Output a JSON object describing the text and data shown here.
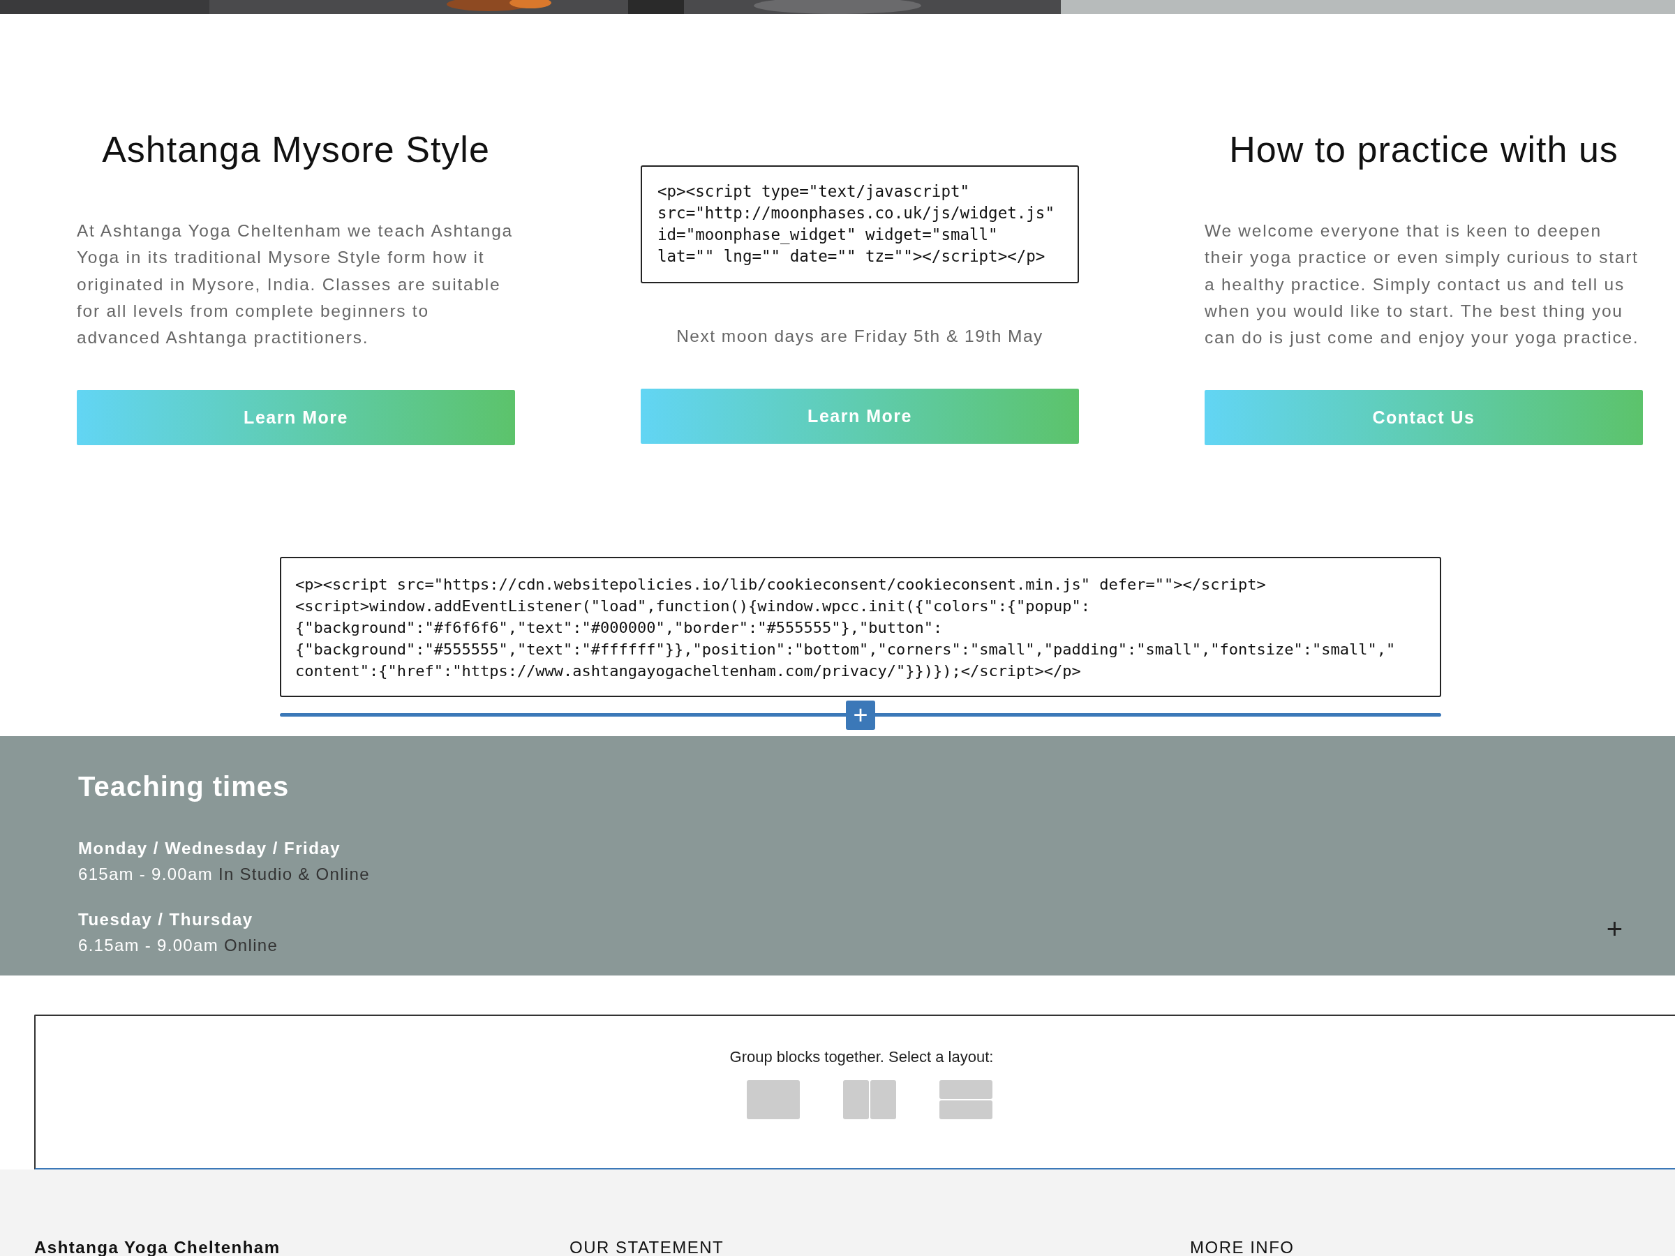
{
  "banner": {
    "kind": "picture"
  },
  "columns": [
    {
      "kind": "text",
      "heading": "Ashtanga Mysore Style",
      "text": "At Ashtanga Yoga Cheltenham we teach Ashtanga Yoga in its traditional Mysore Style form how it originated in Mysore, India. Classes are suitable for all levels from complete beginners to advanced Ashtanga practitioners.",
      "button": "Learn More"
    },
    {
      "kind": "code",
      "code": [
        "<p><script type=\"text/javascript\"",
        "src=\"http://moonphases.co.uk/js/widget.js\"",
        "id=\"moonphase_widget\" widget=\"small\"",
        "lat=\"\" lng=\"\" date=\"\" tz=\"\"></script></p>"
      ],
      "text": "Next moon days are Friday 5th & 19th May",
      "button": "Learn More"
    },
    {
      "kind": "text",
      "heading": "How to practice with us",
      "text": "We welcome everyone that is keen to deepen their yoga practice or even simply curious to start a healthy practice. Simply contact us and tell us when you would like to start. The best thing you can do is just come and enjoy your yoga practice.",
      "button": "Contact Us"
    }
  ],
  "code_block": [
    "<p><script src=\"https://cdn.websitepolicies.io/lib/cookieconsent/cookieconsent.min.js\" defer=\"\"></script>",
    "<script>window.addEventListener(\"load\",function(){window.wpcc.init({\"colors\":{\"popup\":",
    "{\"background\":\"#f6f6f6\",\"text\":\"#000000\",\"border\":\"#555555\"},\"button\":",
    "{\"background\":\"#555555\",\"text\":\"#ffffff\"}},\"position\":\"bottom\",\"corners\":\"small\",\"padding\":\"small\",\"fontsize\":\"small\",\"",
    "content\":{\"href\":\"https://www.ashtangayogacheltenham.com/privacy/\"}})});</script></p>"
  ],
  "insert_button": "+",
  "teaching": {
    "title": "Teaching times",
    "slots": [
      {
        "days": "Monday / Wednesday / Friday",
        "time": "615am - 9.00am",
        "mode": "In Studio & Online"
      },
      {
        "days": "Tuesday / Thursday",
        "time": "6.15am - 9.00am",
        "mode": "Online"
      }
    ],
    "add": "+"
  },
  "group": {
    "prompt": "Group blocks together. Select a layout:",
    "layouts": [
      {
        "kind": "single"
      },
      {
        "kind": "columns"
      },
      {
        "kind": "rows"
      }
    ]
  },
  "footer": [
    "Ashtanga Yoga Cheltenham",
    "OUR STATEMENT",
    "MORE INFO"
  ]
}
